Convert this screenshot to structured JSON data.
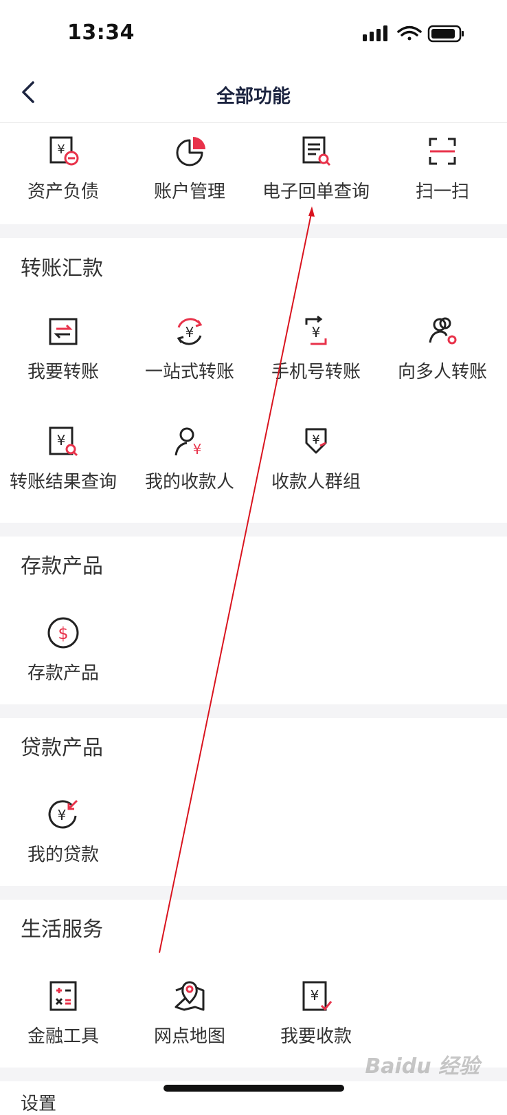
{
  "status_bar": {
    "time": "13:34"
  },
  "nav": {
    "title": "全部功能"
  },
  "quick": [
    {
      "label": "资产负债",
      "icon": "balance-sheet-icon"
    },
    {
      "label": "账户管理",
      "icon": "pie-chart-icon"
    },
    {
      "label": "电子回单查询",
      "icon": "receipt-search-icon"
    },
    {
      "label": "扫一扫",
      "icon": "scan-icon"
    }
  ],
  "sections": {
    "transfer": {
      "title": "转账汇款",
      "items": [
        {
          "label": "我要转账",
          "icon": "transfer-icon"
        },
        {
          "label": "一站式转账",
          "icon": "one-stop-transfer-icon"
        },
        {
          "label": "手机号转账",
          "icon": "phone-transfer-icon"
        },
        {
          "label": "向多人转账",
          "icon": "multi-person-transfer-icon"
        },
        {
          "label": "转账结果查询",
          "icon": "transfer-result-search-icon"
        },
        {
          "label": "我的收款人",
          "icon": "payee-icon"
        },
        {
          "label": "收款人群组",
          "icon": "payee-group-icon"
        }
      ]
    },
    "deposit": {
      "title": "存款产品",
      "items": [
        {
          "label": "存款产品",
          "icon": "dollar-coin-icon"
        }
      ]
    },
    "loan": {
      "title": "贷款产品",
      "items": [
        {
          "label": "我的贷款",
          "icon": "loan-icon"
        }
      ]
    },
    "life": {
      "title": "生活服务",
      "items": [
        {
          "label": "金融工具",
          "icon": "calculator-icon"
        },
        {
          "label": "网点地图",
          "icon": "map-pin-icon"
        },
        {
          "label": "我要收款",
          "icon": "receive-payment-icon"
        }
      ]
    },
    "settings": {
      "title": "设置"
    }
  },
  "watermark": "Baidu 经验",
  "colors": {
    "accent": "#e8324a",
    "icon_dark": "#222222",
    "nav_title": "#1c2440",
    "annotation_arrow": "#d9141f"
  }
}
